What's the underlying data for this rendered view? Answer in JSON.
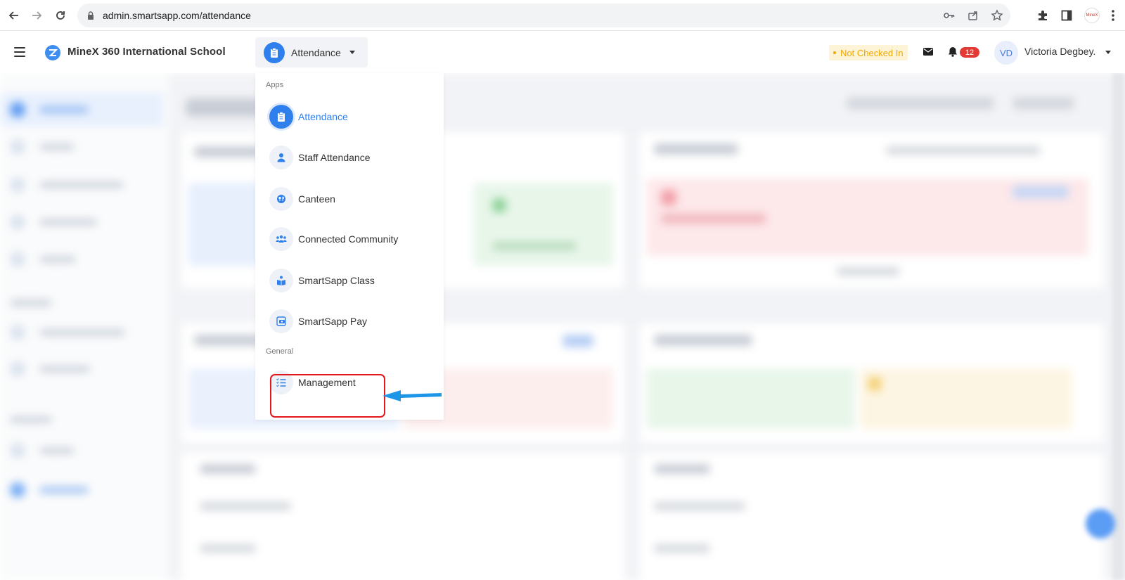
{
  "browser": {
    "url": "admin.smartsapp.com/attendance"
  },
  "header": {
    "school_name": "MineX 360 International School",
    "app_switcher_label": "Attendance",
    "status": "Not Checked In",
    "notification_count": "12",
    "avatar_initials": "VD",
    "user_name": "Victoria Degbey."
  },
  "dropdown": {
    "apps_title": "Apps",
    "apps": [
      {
        "label": "Attendance",
        "icon": "clipboard-icon",
        "active": true
      },
      {
        "label": "Staff Attendance",
        "icon": "person-icon",
        "active": false
      },
      {
        "label": "Canteen",
        "icon": "food-icon",
        "active": false
      },
      {
        "label": "Connected Community",
        "icon": "community-icon",
        "active": false
      },
      {
        "label": "SmartSapp Class",
        "icon": "book-reader-icon",
        "active": false
      },
      {
        "label": "SmartSapp Pay",
        "icon": "payment-icon",
        "active": false
      }
    ],
    "general_title": "General",
    "general": [
      {
        "label": "Management",
        "icon": "checklist-icon",
        "highlighted": true
      }
    ]
  },
  "colors": {
    "accent": "#2f80ed",
    "status_text": "#f0a800",
    "status_bg": "#fdf3d6",
    "badge": "#e53935",
    "annotation_box": "#e3171c",
    "annotation_arrow": "#1e96e8"
  }
}
